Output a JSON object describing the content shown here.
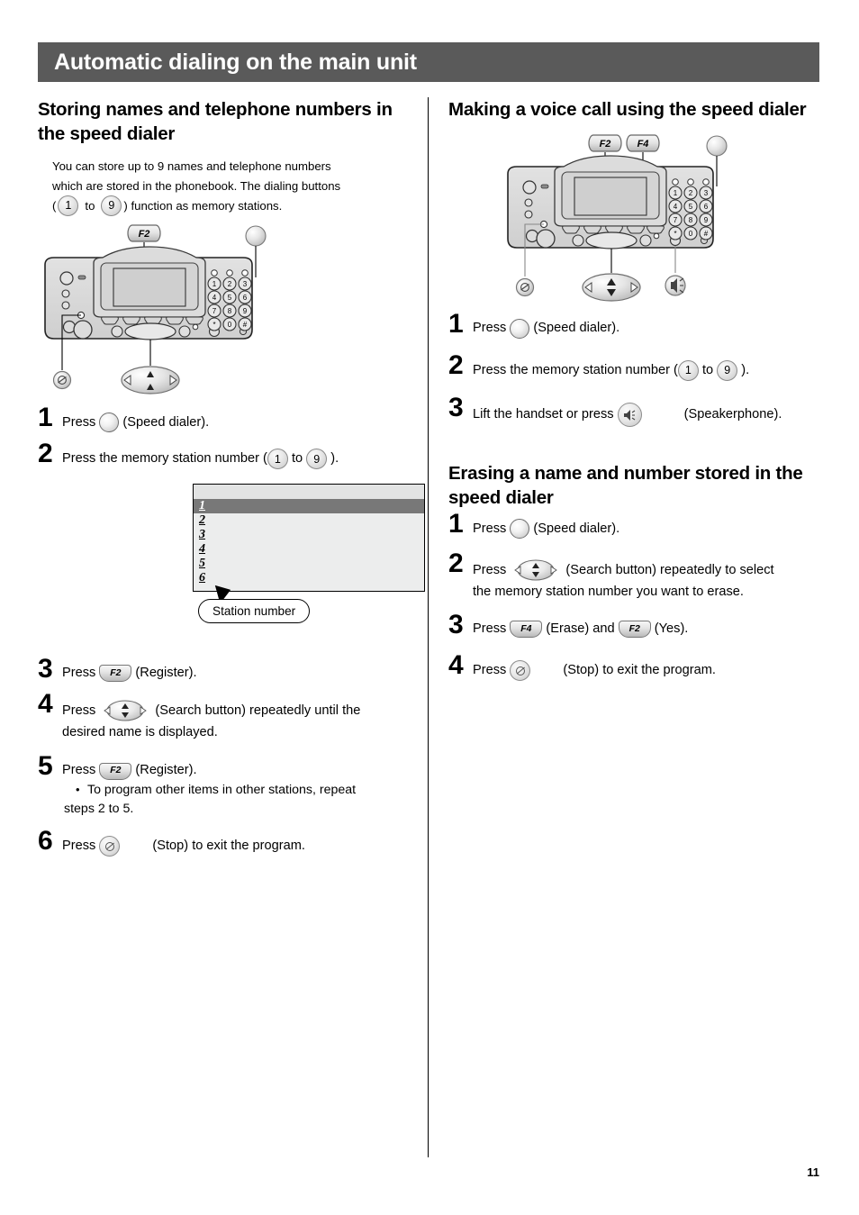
{
  "page": {
    "title": "Automatic dialing on the main unit",
    "number": "11",
    "header_bg": "#5a5a5a"
  },
  "left_column": {
    "heading": "Storing names and telephone numbers in the speed dialer",
    "intro": {
      "line1": "You can store up to 9 names and telephone numbers",
      "line2": "which are stored in the phonebook. The dialing buttons",
      "line3_open": "(",
      "line3_key_from": "1",
      "line3_to": "to",
      "line3_key_to": "9",
      "line3_close": ") function as memory stations."
    },
    "figure": {
      "label_f2": "F2",
      "caption_keys": [
        "F2",
        "speed-dialer",
        "stop",
        "search"
      ]
    },
    "steps": [
      {
        "num": "1",
        "pre": "Press ",
        "key": "speed-dialer",
        "post": " (Speed dialer)."
      },
      {
        "num": "2",
        "pre": "Press the memory station number (",
        "key_from": "1",
        "mid": " to ",
        "key_to": "9",
        "post": " )."
      },
      {
        "num": "3",
        "pre": "Press ",
        "key": "F2",
        "post": " (Register)."
      },
      {
        "num": "4",
        "pre": "Press ",
        "key": "search",
        "post": " (Search button) repeatedly until the",
        "cont": "desired name is displayed."
      },
      {
        "num": "5",
        "pre": "Press ",
        "key": "F2",
        "post": " (Register).",
        "bullet1": "To program other items in other stations, repeat",
        "bullet2": "steps 2 to 5."
      },
      {
        "num": "6",
        "pre": "Press ",
        "key": "stop",
        "post": " (Stop) to exit the program."
      }
    ],
    "lcd": {
      "rows": [
        "1",
        "2",
        "3",
        "4",
        "5",
        "6"
      ],
      "selected_index": 0,
      "callout": "Station number"
    }
  },
  "right_column": {
    "section1": {
      "heading": "Making a voice call using the speed dialer",
      "figure": {
        "label_f2": "F2",
        "label_f4": "F4"
      },
      "steps": [
        {
          "num": "1",
          "pre": "Press ",
          "key": "speed-dialer",
          "post": " (Speed dialer)."
        },
        {
          "num": "2",
          "pre": "Press the memory station number (",
          "key_from": "1",
          "mid": " to ",
          "key_to": "9",
          "post": " )."
        },
        {
          "num": "3",
          "pre": "Lift the handset or press ",
          "key": "speakerphone",
          "post": " (Speakerphone)."
        }
      ]
    },
    "section2": {
      "heading": "Erasing a name and number stored in the speed dialer",
      "steps": [
        {
          "num": "1",
          "pre": "Press ",
          "key": "speed-dialer",
          "post": " (Speed dialer)."
        },
        {
          "num": "2",
          "pre": "Press ",
          "key": "search",
          "post": " (Search button) repeatedly to select",
          "cont": "the memory station number you want to erase."
        },
        {
          "num": "3",
          "pre": "Press ",
          "key": "F4",
          "mid": " (Erase) and ",
          "key2": "F2",
          "post": " (Yes)."
        },
        {
          "num": "4",
          "pre": "Press ",
          "key": "stop",
          "post": " (Stop) to exit the program."
        }
      ]
    }
  }
}
